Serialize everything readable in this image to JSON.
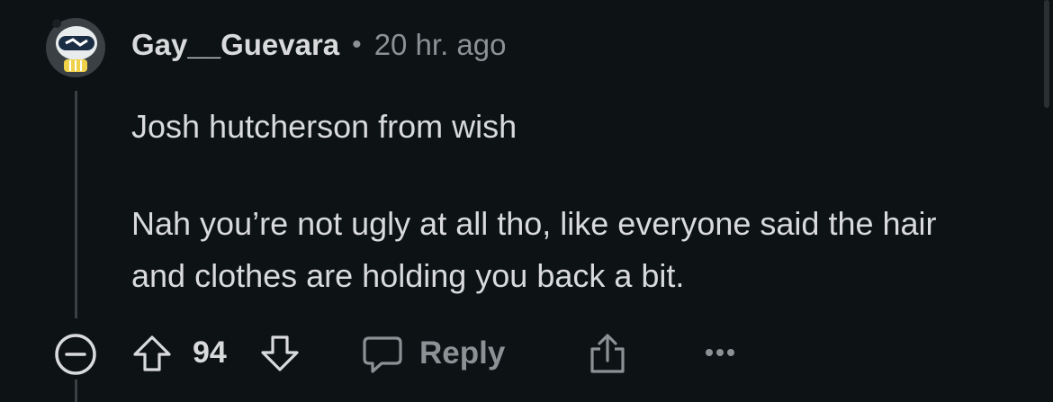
{
  "comment": {
    "username": "Gay__Guevara",
    "separator": "•",
    "timestamp": "20 hr. ago",
    "paragraphs": [
      "Josh hutcherson from wish",
      "Nah you’re not ugly at all tho, like everyone said the hair and clothes are holding you back a bit."
    ]
  },
  "actions": {
    "collapse_icon": "minus-circle-icon",
    "upvote_icon": "arrow-up-icon",
    "vote_count": "94",
    "downvote_icon": "arrow-down-icon",
    "reply_icon": "speech-bubble-icon",
    "reply_label": "Reply",
    "share_icon": "share-icon",
    "more_icon": "ellipsis-icon"
  },
  "colors": {
    "background": "#0d1214",
    "primary_text": "#d8dadb",
    "secondary_text": "#8b9194",
    "thread_line": "#3a4043",
    "avatar_accent": "#f0d24a"
  }
}
